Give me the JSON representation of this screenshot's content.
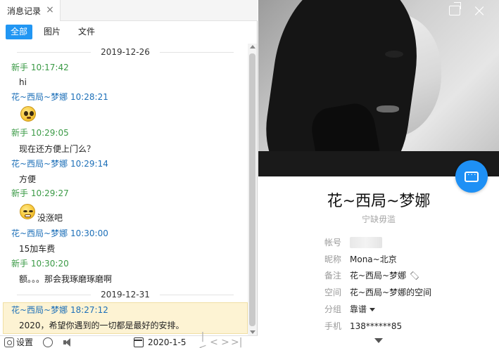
{
  "tab": {
    "label": "消息记录",
    "close_glyph": "×"
  },
  "filters": [
    "全部",
    "图片",
    "文件"
  ],
  "history": {
    "dates": [
      "2019-12-26",
      "2019-12-31"
    ],
    "messages": [
      {
        "sender": "新手",
        "time": "10:17:42",
        "text": "hi",
        "color": "#3a9a45"
      },
      {
        "sender": "花~西局~梦娜",
        "time": "10:28:21",
        "text": "",
        "emoji": "pleading-face-emoji",
        "color": "#1c6fb8"
      },
      {
        "sender": "新手",
        "time": "10:29:05",
        "text": "现在还方便上门么？",
        "color": "#3a9a45"
      },
      {
        "sender": "花~西局~梦娜",
        "time": "10:29:14",
        "text": "方便",
        "color": "#1c6fb8"
      },
      {
        "sender": "新手",
        "time": "10:29:27",
        "text": "没涨吧",
        "emoji": "grimacing-face-emoji",
        "color": "#3a9a45"
      },
      {
        "sender": "花~西局~梦娜",
        "time": "10:30:00",
        "text": "15加车费",
        "color": "#1c6fb8"
      },
      {
        "sender": "新手",
        "time": "10:30:20",
        "text": "额。。。那会我琢磨琢磨啊",
        "color": "#3a9a45"
      },
      {
        "sender": "花~西局~梦娜",
        "time": "18:27:12",
        "text": "2020，希望你遇到的一切都是最好的安排。",
        "color": "#1c6fb8",
        "highlighted": true
      }
    ]
  },
  "bottombar": {
    "settings_label": "设置",
    "date": "2020-1-5",
    "nav_glyphs": [
      "|<",
      "<",
      ">",
      ">|"
    ]
  },
  "profile": {
    "name": "花~西局~梦娜",
    "signature": "宁缺毋滥",
    "fields": [
      {
        "key": "帐号",
        "value": ""
      },
      {
        "key": "昵称",
        "value": "Mona~北京"
      },
      {
        "key": "备注",
        "value": "花~西局~梦娜"
      },
      {
        "key": "空间",
        "value": "花~西局~梦娜的空间"
      },
      {
        "key": "分组",
        "value": "靠谱"
      },
      {
        "key": "手机",
        "value": "138******85"
      }
    ]
  },
  "colors": {
    "accent": "#2196f3",
    "fab": "#1e90f5",
    "highlight_bg": "#fdf3d3",
    "green_sender": "#3a9a45",
    "blue_sender": "#1c6fb8"
  }
}
